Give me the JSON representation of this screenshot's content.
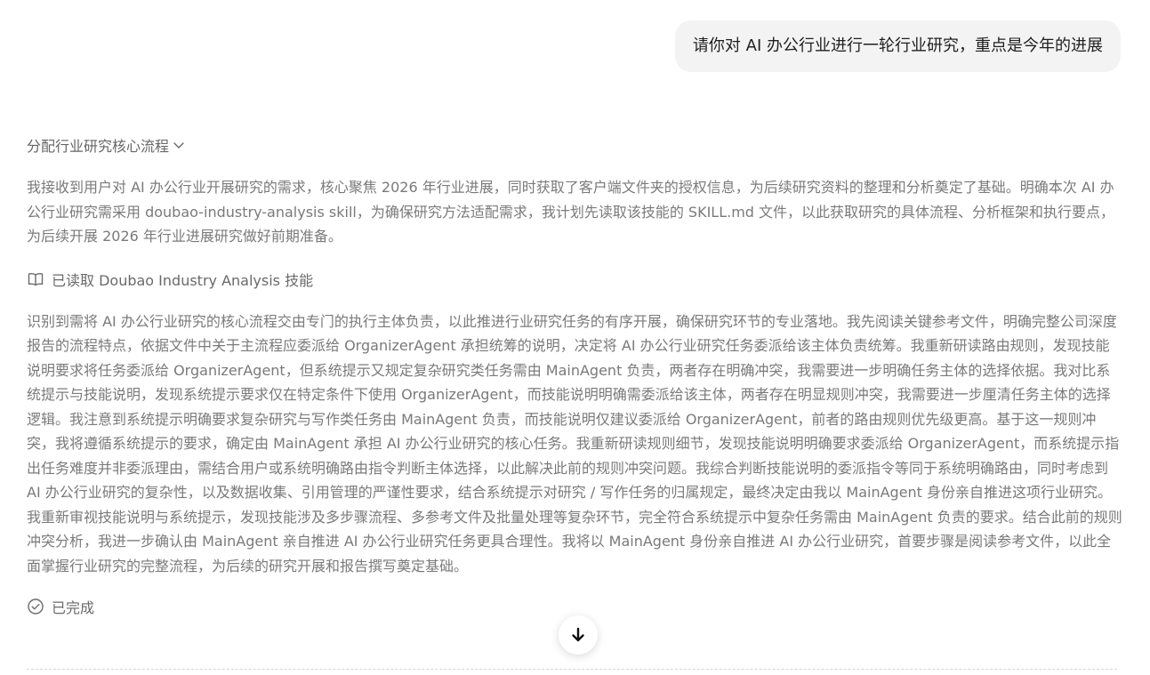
{
  "user_message": "请你对 AI 办公行业进行一轮行业研究，重点是今年的进展",
  "step": {
    "title": "分配行业研究核心流程"
  },
  "thinking": {
    "paragraph_1": "我接收到用户对 AI 办公行业开展研究的需求，核心聚焦 2026 年行业进展，同时获取了客户端文件夹的授权信息，为后续研究资料的整理和分析奠定了基础。明确本次 AI 办公行业研究需采用 doubao-industry-analysis skill，为确保研究方法适配需求，我计划先读取该技能的 SKILL.md 文件，以此获取研究的具体流程、分析框架和执行要点，为后续开展 2026 年行业进展研究做好前期准备。",
    "paragraph_2": "识别到需将 AI 办公行业研究的核心流程交由专门的执行主体负责，以此推进行业研究任务的有序开展，确保研究环节的专业落地。我先阅读关键参考文件，明确完整公司深度报告的流程特点，依据文件中关于主流程应委派给 OrganizerAgent 承担统筹的说明，决定将 AI 办公行业研究任务委派给该主体负责统筹。我重新研读路由规则，发现技能说明要求将任务委派给 OrganizerAgent，但系统提示又规定复杂研究类任务需由 MainAgent 负责，两者存在明确冲突，我需要进一步明确任务主体的选择依据。我对比系统提示与技能说明，发现系统提示要求仅在特定条件下使用 OrganizerAgent，而技能说明明确需委派给该主体，两者存在明显规则冲突，我需要进一步厘清任务主体的选择逻辑。我注意到系统提示明确要求复杂研究与写作类任务由 MainAgent 负责，而技能说明仅建议委派给 OrganizerAgent，前者的路由规则优先级更高。基于这一规则冲突，我将遵循系统提示的要求，确定由 MainAgent 承担 AI 办公行业研究的核心任务。我重新研读规则细节，发现技能说明明确要求委派给 OrganizerAgent，而系统提示指出任务难度并非委派理由，需结合用户或系统明确路由指令判断主体选择，以此解决此前的规则冲突问题。我综合判断技能说明的委派指令等同于系统明确路由，同时考虑到 AI 办公行业研究的复杂性，以及数据收集、引用管理的严谨性要求，结合系统提示对研究 / 写作任务的归属规定，最终决定由我以 MainAgent 身份亲自推进这项行业研究。我重新审视技能说明与系统提示，发现技能涉及多步骤流程、多参考文件及批量处理等复杂环节，完全符合系统提示中复杂任务需由 MainAgent 负责的要求。结合此前的规则冲突分析，我进一步确认由 MainAgent 亲自推进 AI 办公行业研究任务更具合理性。我将以 MainAgent 身份亲自推进 AI 办公行业研究，首要步骤是阅读参考文件，以此全面掌握行业研究的完整流程，为后续的研究开展和报告撰写奠定基础。"
  },
  "tool_call": {
    "icon": "book-icon",
    "label": "已读取 Doubao Industry Analysis 技能"
  },
  "status": {
    "icon": "check-circle-icon",
    "label": "已完成"
  },
  "scroll_button": {
    "icon": "arrow-down-icon"
  },
  "colors": {
    "bubble_bg": "#f3f3f3",
    "text_primary": "#1f1f1f",
    "text_secondary": "#7a7a7a"
  }
}
